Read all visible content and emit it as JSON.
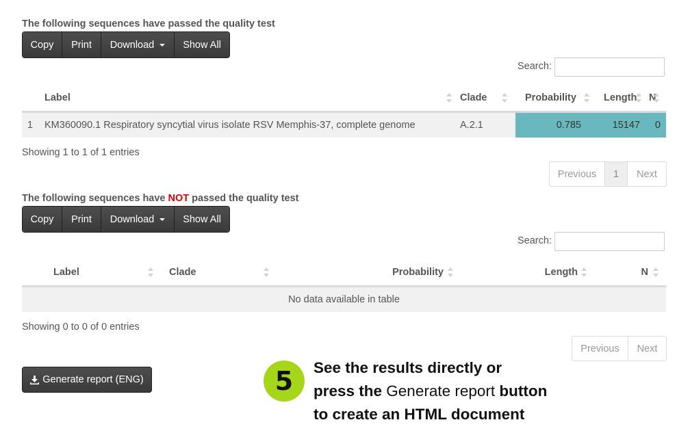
{
  "passed": {
    "title": "The following sequences have passed the quality test",
    "buttons": {
      "copy": "Copy",
      "print": "Print",
      "download": "Download",
      "show_all": "Show All"
    },
    "search_label": "Search:",
    "columns": {
      "index": "",
      "label": "Label",
      "clade": "Clade",
      "probability": "Probability",
      "length": "Length",
      "n": "N"
    },
    "rows": [
      {
        "index": "1",
        "label": "KM360090.1 Respiratory syncytial virus isolate RSV Memphis-37, complete genome",
        "clade": "A.2.1",
        "probability": "0.785",
        "length": "15147",
        "n": "0"
      }
    ],
    "info": "Showing 1 to 1 of 1 entries",
    "pager": {
      "previous": "Previous",
      "page": "1",
      "next": "Next"
    }
  },
  "failed": {
    "title_prefix": "The following sequences have ",
    "title_not": "NOT",
    "title_suffix": " passed the quality test",
    "buttons": {
      "copy": "Copy",
      "print": "Print",
      "download": "Download",
      "show_all": "Show All"
    },
    "search_label": "Search:",
    "columns": {
      "label": "Label",
      "clade": "Clade",
      "probability": "Probability",
      "length": "Length",
      "n": "N"
    },
    "empty": "No data available in table",
    "info": "Showing 0 to 0 of 0 entries",
    "pager": {
      "previous": "Previous",
      "next": "Next"
    }
  },
  "generate_button": {
    "label": "Generate report (ENG)",
    "icon": "download-icon"
  },
  "callout": {
    "step": "5",
    "line1": "See the results directly or",
    "line2_bold": "press the ",
    "line2_normal": "Generate report",
    "line2_bold_end": " button",
    "line3": "to create an HTML document"
  },
  "colors": {
    "highlight": "#6ab8bf",
    "not": "#e00000",
    "step": "#a6d61a"
  }
}
